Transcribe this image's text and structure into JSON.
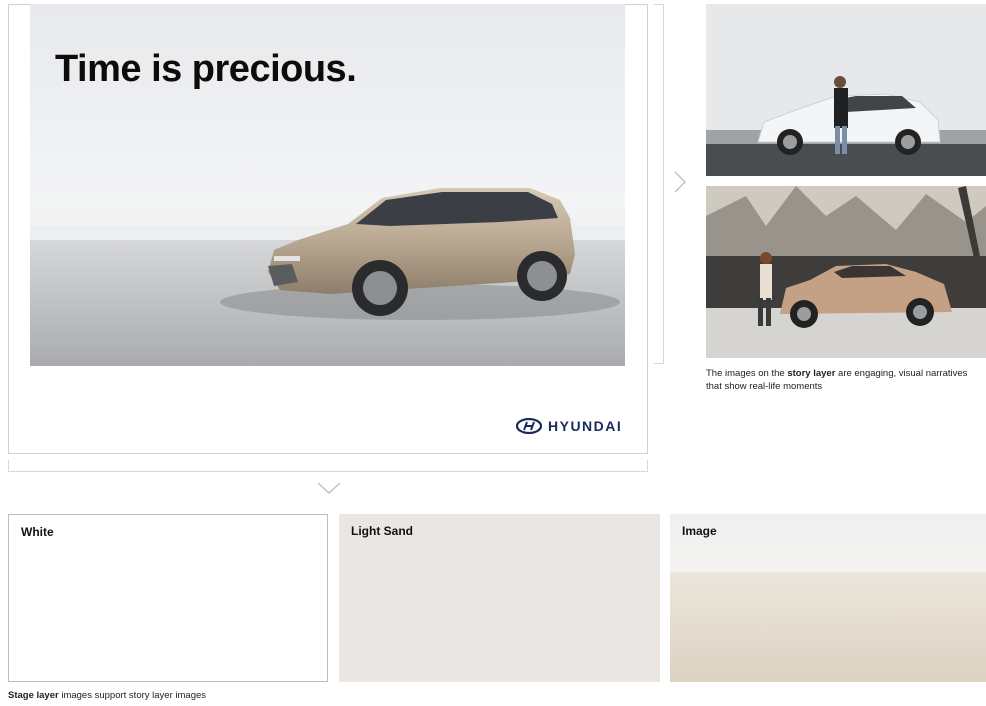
{
  "stage": {
    "headline": "Time is precious.",
    "brand_name": "HYUNDAI"
  },
  "story": {
    "caption_part1": "The images on the ",
    "caption_bold": "story layer",
    "caption_part2": " are engaging, visual narratives that show real-life moments"
  },
  "swatches": [
    {
      "label": "White",
      "color": "#ffffff"
    },
    {
      "label": "Light Sand",
      "color": "#e9e6e4"
    },
    {
      "label": "Image"
    }
  ],
  "footer": {
    "caption_bold": "Stage layer",
    "caption_rest": " images support story layer images"
  },
  "colors": {
    "brand_blue": "#1a2b5a",
    "light_sand": "#e9e6e4"
  }
}
